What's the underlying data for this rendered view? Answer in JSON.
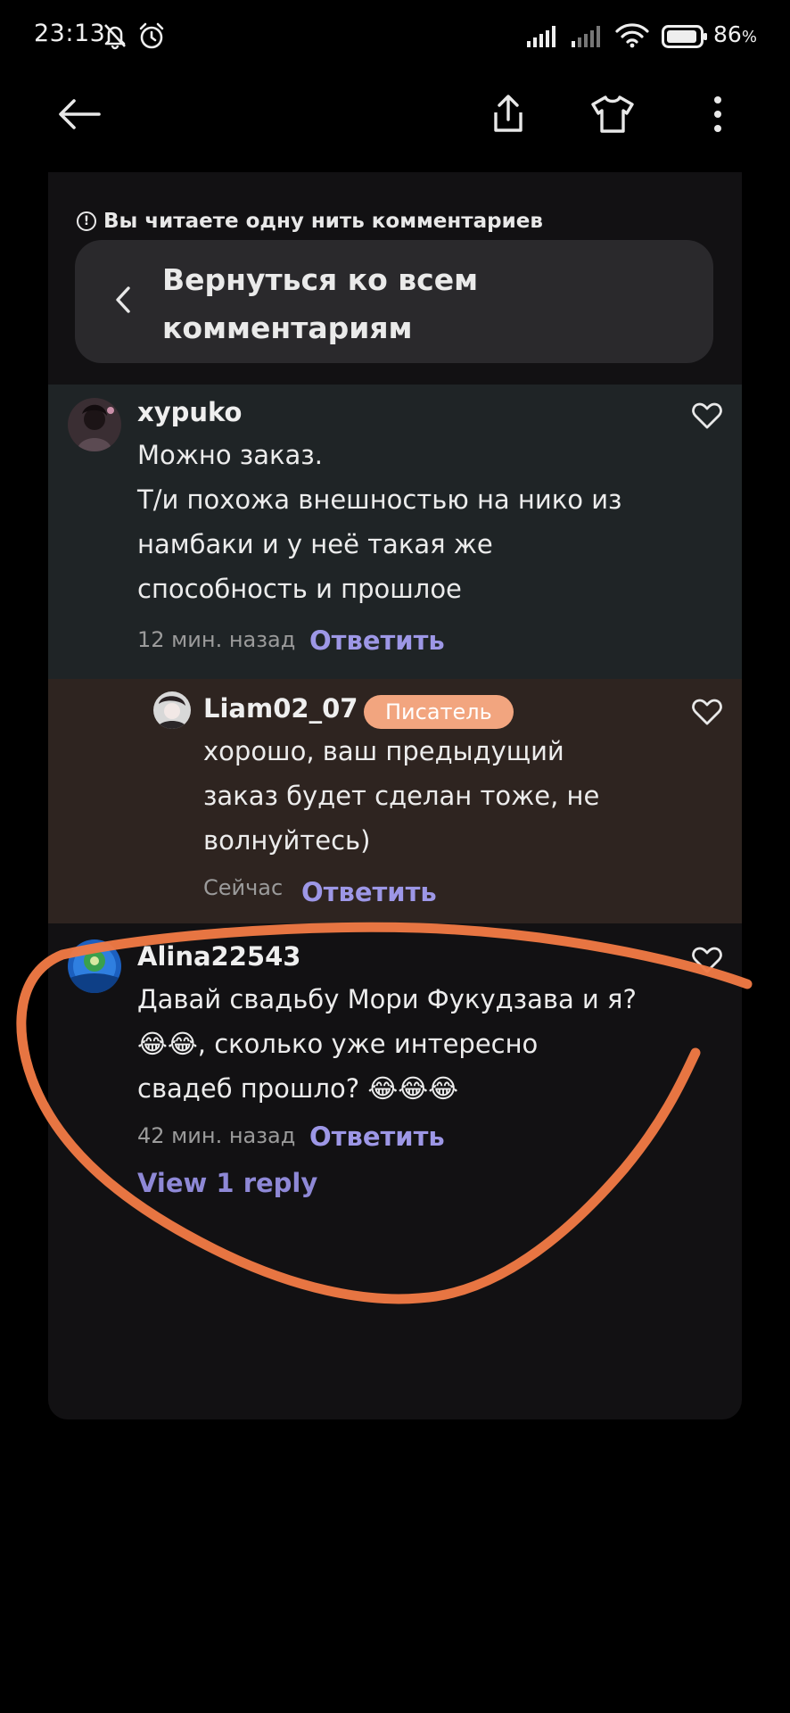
{
  "status_bar": {
    "time": "23:13",
    "battery_percent": "86",
    "battery_unit": "%",
    "icons": [
      "bell-off-icon",
      "alarm-icon",
      "signal-icon",
      "signal-icon",
      "wifi-icon",
      "battery-icon"
    ]
  },
  "nav": {
    "icons": [
      "back-arrow-icon",
      "share-icon",
      "shirt-icon",
      "more-vertical-icon"
    ]
  },
  "thread": {
    "notice": "Вы читаете одну нить комментариев",
    "back_line1": "Вернуться ко всем",
    "back_line2": "комментариям"
  },
  "comments": [
    {
      "username": "xypuko",
      "lines": [
        "Можно заказ.",
        "Т/и похожа внешностью на нико из",
        "намбаки и  у неё такая же",
        "способность и прошлое"
      ],
      "time": "12 мин. назад",
      "reply_label": "Ответить"
    },
    {
      "username": "Liam02_07",
      "badge": "Писатель",
      "lines": [
        "хорошо, ваш предыдущий",
        "заказ будет сделан тоже, не",
        "волнуйтесь)"
      ],
      "time": "Сейчас",
      "reply_label": "Ответить"
    },
    {
      "username": "Alina22543",
      "lines": [
        "Давай свадьбу Мори Фукудзава и я?",
        "😂😂, сколько уже интересно",
        "свадеб прошло? 😂😂😂"
      ],
      "time": "42 мин. назад",
      "reply_label": "Ответить",
      "view_replies": "View 1 reply"
    }
  ],
  "colors": {
    "background": "#000000",
    "panel": "#121113",
    "accent_link": "#9d97e6",
    "writer_badge": "#f2a57f",
    "highlight_comment_bg": "#1f2426",
    "author_reply_bg": "#2e2420",
    "annotation_stroke": "#f07a45"
  }
}
